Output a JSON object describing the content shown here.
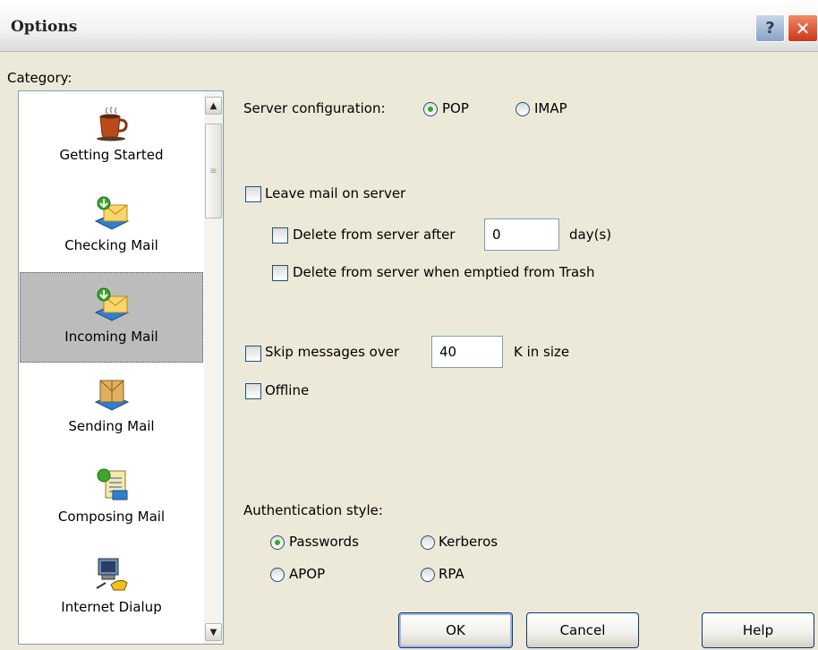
{
  "window": {
    "title": "Options",
    "help_glyph": "?",
    "close_glyph": "✕"
  },
  "category": {
    "label": "Category:",
    "items": [
      {
        "label": "Getting Started",
        "icon": "coffee-cup-icon"
      },
      {
        "label": "Checking Mail",
        "icon": "checking-mail-icon"
      },
      {
        "label": "Incoming Mail",
        "icon": "incoming-mail-icon",
        "selected": true
      },
      {
        "label": "Sending Mail",
        "icon": "sending-mail-icon"
      },
      {
        "label": "Composing Mail",
        "icon": "composing-mail-icon"
      },
      {
        "label": "Internet Dialup",
        "icon": "computer-phone-icon"
      }
    ]
  },
  "server": {
    "label": "Server configuration:",
    "options": [
      {
        "label": "POP",
        "selected": true
      },
      {
        "label": "IMAP",
        "selected": false
      }
    ]
  },
  "leave_mail": {
    "label": "Leave mail on server",
    "checked": false,
    "delete_after_label": "Delete from server after",
    "delete_after_checked": false,
    "days_value": "0",
    "days_unit": "day(s)",
    "delete_trash_label": "Delete from server when emptied from Trash",
    "delete_trash_checked": false
  },
  "skip": {
    "label": "Skip messages over",
    "checked": false,
    "value": "40",
    "unit": "K in size"
  },
  "offline": {
    "label": "Offline",
    "checked": false
  },
  "auth": {
    "label": "Authentication style:",
    "options": [
      {
        "label": "Passwords",
        "selected": true
      },
      {
        "label": "Kerberos",
        "selected": false
      },
      {
        "label": "APOP",
        "selected": false
      },
      {
        "label": "RPA",
        "selected": false
      }
    ]
  },
  "buttons": {
    "ok": "OK",
    "cancel": "Cancel",
    "help": "Help"
  }
}
